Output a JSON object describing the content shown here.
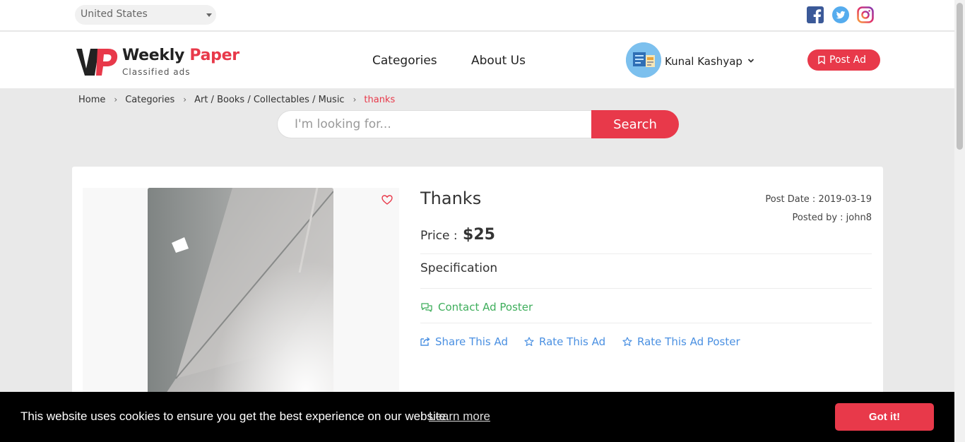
{
  "topbar": {
    "country_select": "United States",
    "social": [
      "facebook-icon",
      "twitter-icon",
      "instagram-icon"
    ]
  },
  "header": {
    "logo_title_main": "Weekly ",
    "logo_title_accent": "Paper",
    "logo_subtitle": "Classified ads",
    "nav": {
      "categories": "Categories",
      "about": "About Us"
    },
    "user_name": "Kunal Kashyap",
    "post_ad_label": "Post Ad"
  },
  "breadcrumb": {
    "items": [
      "Home",
      "Categories",
      "Art / Books / Collectables / Music",
      "thanks"
    ]
  },
  "search": {
    "placeholder": "I'm looking for...",
    "button_label": "Search"
  },
  "ad": {
    "title": "Thanks",
    "post_date": "Post Date : 2019-03-19",
    "posted_by": "Posted by : john8",
    "price_label": "Price :",
    "price_value": "$25",
    "specification_label": "Specification",
    "contact_label": "Contact Ad Poster",
    "share_label": "Share This Ad",
    "rate_label": "Rate This Ad",
    "rate_poster_label": "Rate This Ad Poster"
  },
  "cookie": {
    "message": "This website uses cookies to ensure you get the best experience on our website.",
    "learn_more": "Learn more",
    "accept": "Got it!"
  },
  "colors": {
    "accent": "#e8394a",
    "contact_green": "#3fae5c",
    "action_blue": "#4a90e2"
  }
}
